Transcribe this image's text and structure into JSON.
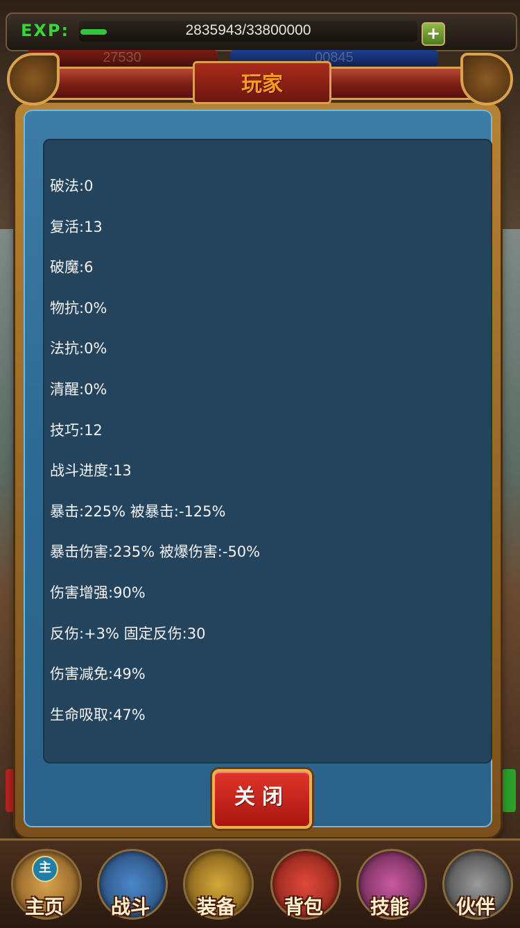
{
  "topbar": {
    "exp_label": "EXP:",
    "exp_value": "2835943/33800000",
    "exp_progress": 0.084,
    "add_symbol": "+",
    "hp_partial": "27530",
    "mp_partial": "00845"
  },
  "dialog": {
    "title": "玩家",
    "stats": [
      "破法:0",
      "复活:13",
      "破魔:6",
      "物抗:0%",
      "法抗:0%",
      "清醒:0%",
      "技巧:12",
      "战斗进度:13",
      "暴击:225% 被暴击:-125%",
      "暴击伤害:235% 被爆伤害:-50%",
      "伤害增强:90%",
      "反伤:+3% 固定反伤:30",
      "伤害减免:49%",
      "生命吸取:47%"
    ],
    "clipped_line": "··· · ··",
    "close_label": "关闭"
  },
  "nav": {
    "items": [
      {
        "label": "主页",
        "icon": "home-icon",
        "badge": "主"
      },
      {
        "label": "战斗",
        "icon": "battle-icon"
      },
      {
        "label": "装备",
        "icon": "equipment-icon"
      },
      {
        "label": "背包",
        "icon": "bag-icon"
      },
      {
        "label": "技能",
        "icon": "skill-icon"
      },
      {
        "label": "伙伴",
        "icon": "partner-icon"
      }
    ]
  },
  "colors": {
    "exp_green": "#39d43a",
    "title_orange": "#ff9a1f",
    "panel_blue": "#2d6a93",
    "content_navy": "#24435c",
    "close_red": "#e1352b",
    "frame_gold": "#d8a24e"
  }
}
